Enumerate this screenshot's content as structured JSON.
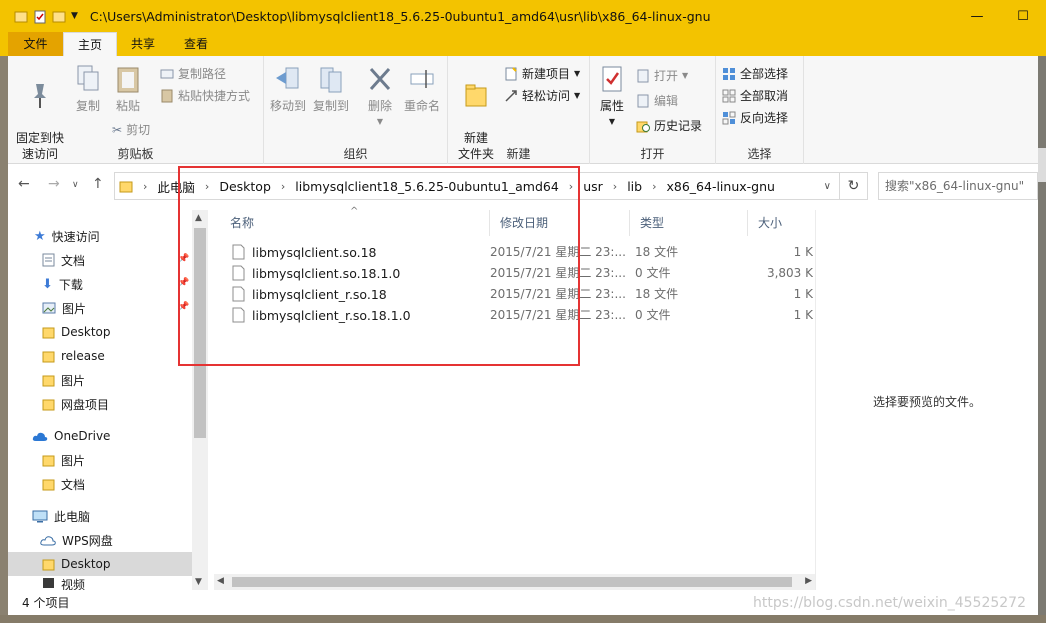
{
  "window": {
    "title_path": "C:\\Users\\Administrator\\Desktop\\libmysqlclient18_5.6.25-0ubuntu1_amd64\\usr\\lib\\x86_64-linux-gnu",
    "minimize": "—",
    "maximize": "☐"
  },
  "tabs": [
    {
      "label": "文件"
    },
    {
      "label": "主页"
    },
    {
      "label": "共享"
    },
    {
      "label": "查看"
    }
  ],
  "ribbon": {
    "clipboard": {
      "label": "剪贴板",
      "pin": "固定到快\n速访问",
      "copy": "复制",
      "paste": "粘贴",
      "copy_path": "复制路径",
      "paste_shortcut": "粘贴快捷方式",
      "cut": "剪切"
    },
    "organize": {
      "label": "组织",
      "move_to": "移动到",
      "copy_to": "复制到",
      "delete": "删除",
      "rename": "重命名"
    },
    "new": {
      "label": "新建",
      "new_folder": "新建\n文件夹",
      "new_item": "新建项目",
      "easy_access": "轻松访问"
    },
    "open": {
      "label": "打开",
      "properties": "属性",
      "open": "打开",
      "edit": "编辑",
      "history": "历史记录"
    },
    "select": {
      "label": "选择",
      "select_all": "全部选择",
      "select_none": "全部取消",
      "invert": "反向选择"
    }
  },
  "address": {
    "crumbs": [
      "此电脑",
      "Desktop",
      "libmysqlclient18_5.6.25-0ubuntu1_amd64",
      "usr",
      "lib",
      "x86_64-linux-gnu"
    ],
    "search_placeholder": "搜索\"x86_64-linux-gnu\""
  },
  "nav": {
    "items": [
      {
        "label": "快速访问",
        "icon": "star-icon"
      },
      {
        "label": "文档",
        "icon": "document-icon"
      },
      {
        "label": "下载",
        "icon": "download-icon"
      },
      {
        "label": "图片",
        "icon": "picture-icon"
      },
      {
        "label": "Desktop",
        "icon": "folder-icon"
      },
      {
        "label": "release",
        "icon": "folder-icon"
      },
      {
        "label": "图片",
        "icon": "folder-icon"
      },
      {
        "label": "网盘项目",
        "icon": "folder-icon"
      },
      {
        "label": "OneDrive",
        "icon": "cloud-icon"
      },
      {
        "label": "图片",
        "icon": "folder-icon"
      },
      {
        "label": "文档",
        "icon": "folder-icon"
      },
      {
        "label": "此电脑",
        "icon": "computer-icon"
      },
      {
        "label": "WPS网盘",
        "icon": "cloud-icon"
      },
      {
        "label": "Desktop",
        "icon": "folder-icon"
      },
      {
        "label": "视频",
        "icon": "video-icon"
      }
    ]
  },
  "files": {
    "columns": [
      "名称",
      "修改日期",
      "类型",
      "大小"
    ],
    "rows": [
      {
        "name": "libmysqlclient.so.18",
        "date": "2015/7/21 星期二 23:...",
        "type": "18 文件",
        "size": "1 K"
      },
      {
        "name": "libmysqlclient.so.18.1.0",
        "date": "2015/7/21 星期二 23:...",
        "type": "0 文件",
        "size": "3,803 K"
      },
      {
        "name": "libmysqlclient_r.so.18",
        "date": "2015/7/21 星期二 23:...",
        "type": "18 文件",
        "size": "1 K"
      },
      {
        "name": "libmysqlclient_r.so.18.1.0",
        "date": "2015/7/21 星期二 23:...",
        "type": "0 文件",
        "size": "1 K"
      }
    ]
  },
  "preview": {
    "message": "选择要预览的文件。"
  },
  "status": {
    "count": "4 个项目",
    "watermark": "https://blog.csdn.net/weixin_45525272"
  },
  "colors": {
    "titlebar": "#f3c300",
    "file_tab": "#e4a300",
    "highlight_box": "#e53333"
  }
}
